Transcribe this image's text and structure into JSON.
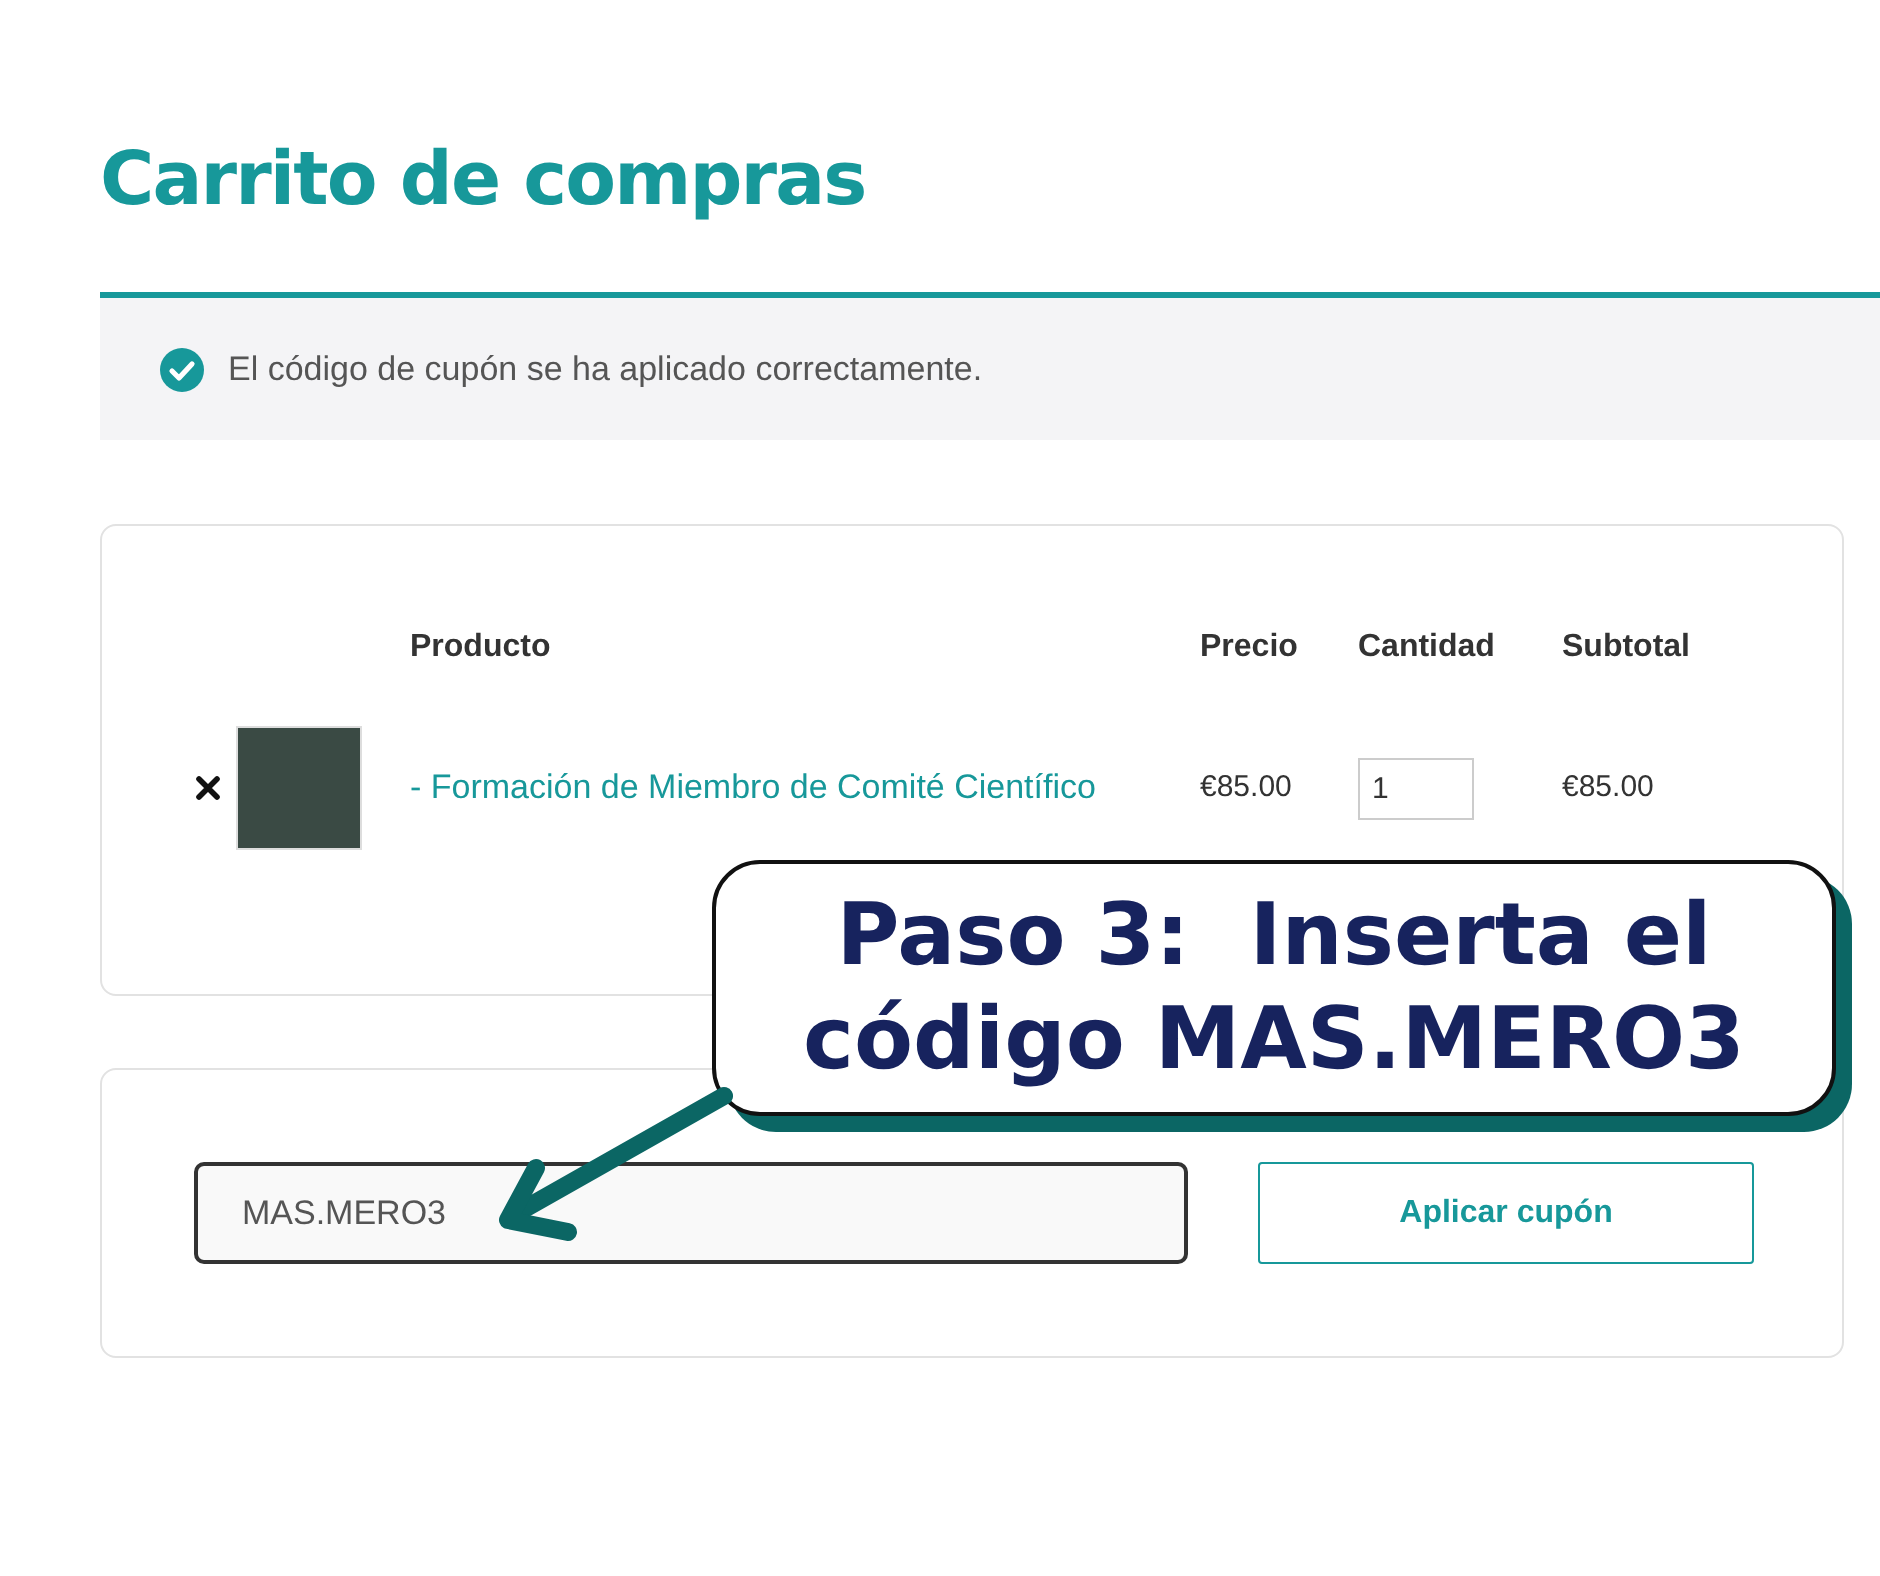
{
  "page_title": "Carrito de compras",
  "notice": {
    "message": "El código de cupón se ha aplicado correctamente."
  },
  "cart": {
    "columns": [
      "Producto",
      "Precio",
      "Cantidad",
      "Subtotal"
    ],
    "rows": [
      {
        "product": "- Formación de Miembro de Comité Científico",
        "price": "€85.00",
        "quantity": "1",
        "subtotal": "€85.00"
      }
    ]
  },
  "coupon": {
    "value": "MAS.MERO3",
    "button": "Aplicar cupón"
  },
  "callout": {
    "lines": [
      "Paso 3:  Inserta el",
      "código MAS.MERO3"
    ]
  }
}
